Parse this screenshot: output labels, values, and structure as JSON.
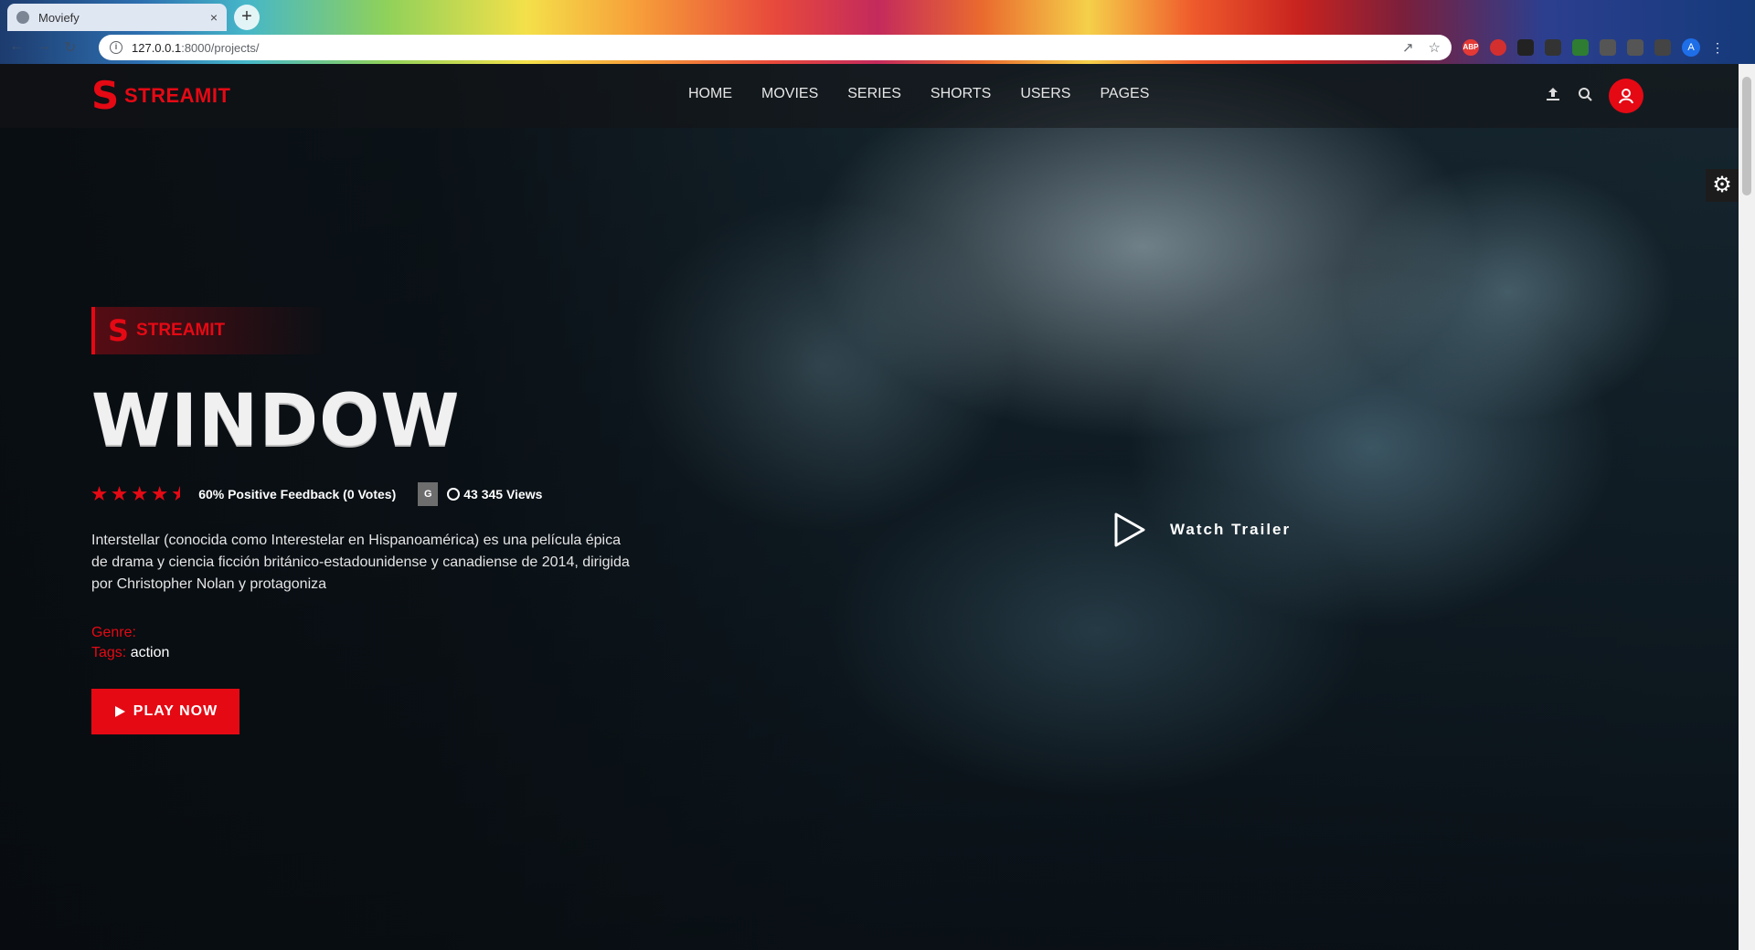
{
  "browser": {
    "tab_title": "Moviefy",
    "tab_close": "×",
    "new_tab": "+",
    "url_host": "127.0.0.1",
    "url_path": ":8000/projects/"
  },
  "site": {
    "logo_letter": "S",
    "logo_text": "STREAMIT",
    "nav": [
      "HOME",
      "MOVIES",
      "SERIES",
      "SHORTS",
      "USERS",
      "PAGES"
    ],
    "accent_color": "#e50914"
  },
  "hero": {
    "brand_letter": "S",
    "brand_text": "STREAMIT",
    "title": "WINDOW",
    "rating_stars": 4.5,
    "feedback": "60% Positive Feedback (0 Votes)",
    "age_rating": "G",
    "views": "43 345 Views",
    "description": "Interstellar (conocida como Interestelar en Hispanoamérica) es una película épica de drama y ciencia ficción británico-estadounidense y canadiense de 2014, dirigida por Christopher Nolan y protagoniza",
    "genre_label": "Genre:",
    "genre_value": "",
    "tags_label": "Tags:",
    "tags_value": "action",
    "play_label": "PLAY NOW",
    "trailer_label": "Watch Trailer"
  }
}
